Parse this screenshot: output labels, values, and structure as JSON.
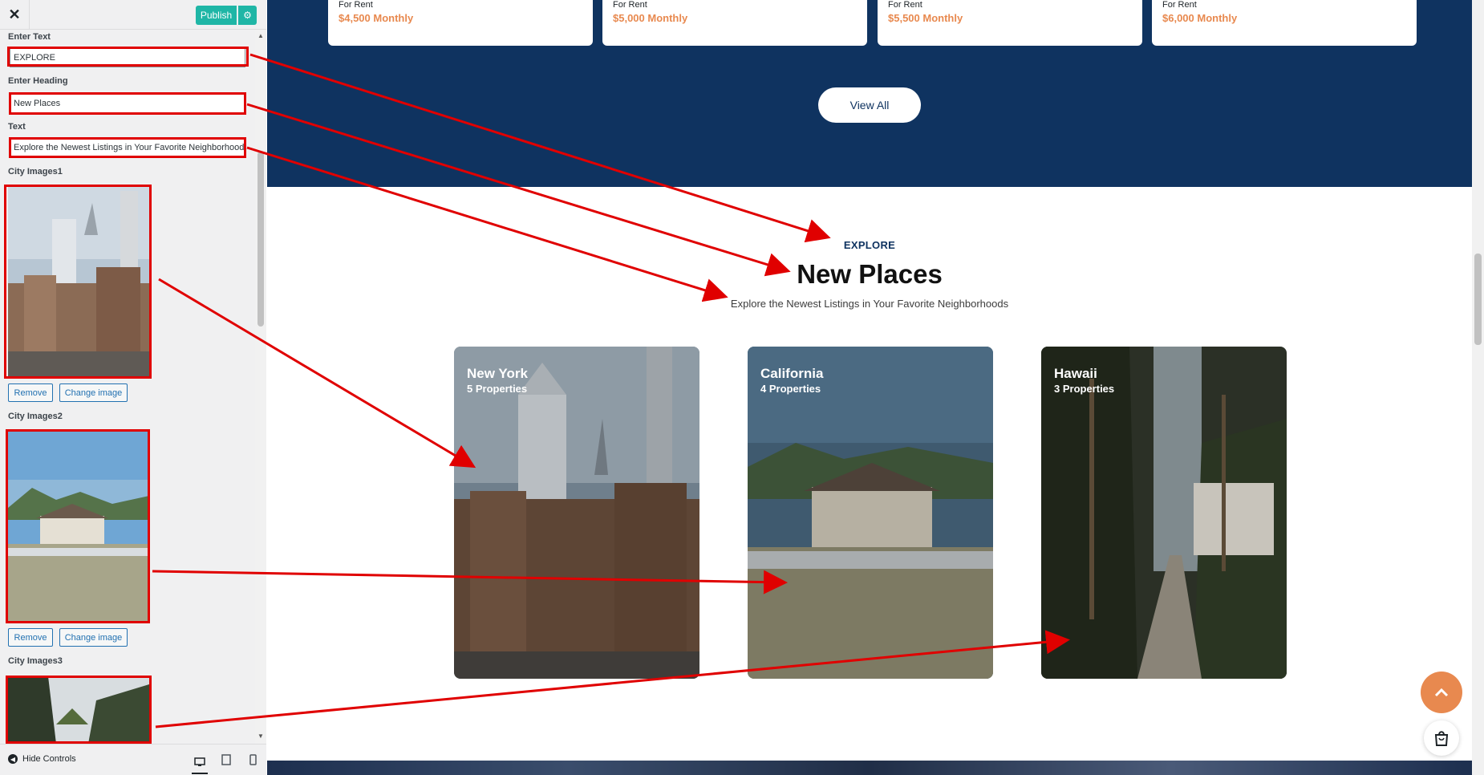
{
  "customizer": {
    "close_label": "✕",
    "publish_label": "Publish",
    "gear_label": "⚙",
    "fields": [
      {
        "label": "Enter Text",
        "value": "EXPLORE"
      },
      {
        "label": "Enter Heading",
        "value": "New Places"
      },
      {
        "label": "Text",
        "value": "Explore the Newest Listings in Your Favorite Neighborhoods"
      }
    ],
    "images": [
      {
        "label": "City Images1",
        "remove_label": "Remove",
        "change_label": "Change image"
      },
      {
        "label": "City Images2",
        "remove_label": "Remove",
        "change_label": "Change image"
      },
      {
        "label": "City Images3"
      }
    ],
    "hide_controls_label": "Hide Controls"
  },
  "rent_cards": [
    {
      "tag": "For Rent",
      "price": "$4,500 Monthly"
    },
    {
      "tag": "For Rent",
      "price": "$5,000 Monthly"
    },
    {
      "tag": "For Rent",
      "price": "$5,500 Monthly"
    },
    {
      "tag": "For Rent",
      "price": "$6,000 Monthly"
    }
  ],
  "view_all_label": "View All",
  "section": {
    "explore": "EXPLORE",
    "heading": "New Places",
    "subtext": "Explore the Newest Listings in Your Favorite Neighborhoods"
  },
  "cities": [
    {
      "name": "New York",
      "count": "5 Properties"
    },
    {
      "name": "California",
      "count": "4 Properties"
    },
    {
      "name": "Hawaii",
      "count": "3 Properties"
    }
  ],
  "colors": {
    "accent_orange": "#e8894f",
    "navy": "#0f3360",
    "publish_teal": "#1fb6a6",
    "annotation_red": "#e00000"
  }
}
